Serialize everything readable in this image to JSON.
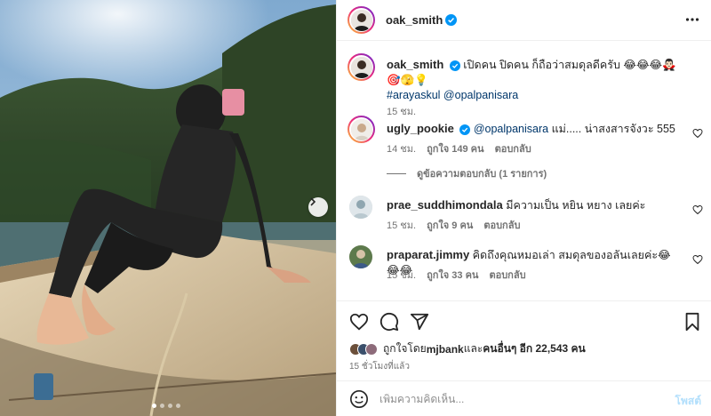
{
  "post": {
    "author": "oak_smith",
    "caption": "เปิดคน ปิดคน ก็ถือว่าสมดุลดีครับ 😂😂😂🧛🏻‍♂️🎯🫣💡",
    "mentions": "#arayaskul @opalpanisara",
    "caption_time": "15 ชม.",
    "likes_text_prefix": "ถูกใจโดย ",
    "likes_user": "mjbank",
    "likes_text_mid": " และ",
    "likes_others": "คนอื่นๆ อีก 22,543 คน",
    "posted_ago": "15 ชั่วโมงที่แล้ว",
    "carousel_count": 4,
    "carousel_active": 1
  },
  "comments": [
    {
      "user": "ugly_pookie",
      "verified": true,
      "mention": "@opalpanisara",
      "text": " แม่..... น่าสงสารจังวะ 555",
      "time": "14 ชม.",
      "likes": "ถูกใจ 149 คน",
      "reply": "ตอบกลับ"
    },
    {
      "user": "prae_suddhimondala",
      "verified": false,
      "mention": "",
      "text": " มีความเป็น หยิน หยาง เลยค่ะ",
      "time": "15 ชม.",
      "likes": "ถูกใจ 9 คน",
      "reply": "ตอบกลับ"
    },
    {
      "user": "praparat.jimmy",
      "verified": false,
      "mention": "",
      "text": " คิดถึงคุณหมอเล่า สมดุลของอลันเลยค่ะ😂😂😂",
      "time": "15 ชม.",
      "likes": "ถูกใจ 33 คน",
      "reply": "ตอบกลับ"
    }
  ],
  "view_replies": "ดูข้อความตอบกลับ (1 รายการ)",
  "composer": {
    "placeholder": "เพิ่มความคิดเห็น...",
    "post_label": "โพสต์"
  },
  "colors": {
    "verified": "#0095f6",
    "link": "#00376b",
    "muted": "#737373",
    "post_disabled": "#b2dffc"
  }
}
